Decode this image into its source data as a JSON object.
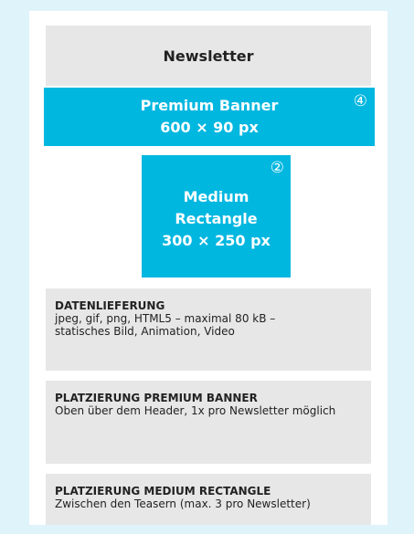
{
  "newsletter": {
    "label": "Newsletter"
  },
  "premium_banner": {
    "title": "Premium Banner",
    "size": "600 × 90 px",
    "badge": "④"
  },
  "medium_rectangle": {
    "title_line1": "Medium",
    "title_line2": "Rectangle",
    "size": "300 × 250 px",
    "badge": "②"
  },
  "delivery": {
    "title": "DATENLIEFERUNG",
    "line1": "jpeg, gif, png, HTML5 – maximal 80 kB –",
    "line2": "statisches Bild, Animation, Video"
  },
  "placement_premium": {
    "title": "PLATZIERUNG PREMIUM BANNER",
    "text": "Oben über dem Header, 1x pro Newsletter möglich"
  },
  "placement_medium": {
    "title": "PLATZIERUNG MEDIUM RECTANGLE",
    "text": "Zwischen den Teasern (max. 3 pro Newsletter)"
  },
  "colors": {
    "background": "#dff3fa",
    "accent": "#00b7e0",
    "panel": "#e7e7e7"
  }
}
